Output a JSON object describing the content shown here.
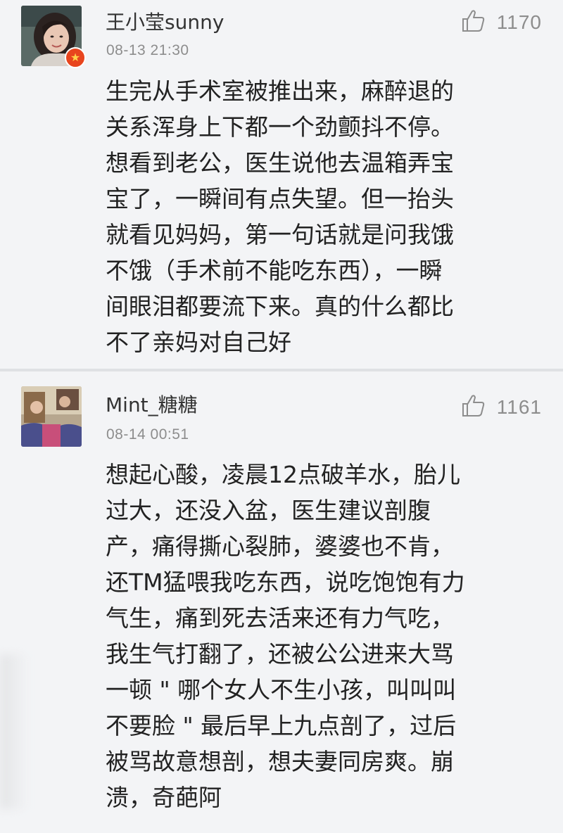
{
  "comments": [
    {
      "username": "王小莹sunny",
      "timestamp": "08-13 21:30",
      "likes": "1170",
      "avatar_icon": "user-avatar-photo",
      "badge_icon": "vip-badge-icon",
      "lines": [
        "生完从手术室被推出来，麻醉退的",
        "关系浑身上下都一个劲颤抖不停。",
        "想看到老公，医生说他去温箱弄宝",
        "宝了，一瞬间有点失望。但一抬头",
        "就看见妈妈，第一句话就是问我饿",
        "不饿（手术前不能吃东西），一瞬",
        "间眼泪都要流下来。真的什么都比",
        "不了亲妈对自己好"
      ]
    },
    {
      "username": "Mint_糖糖",
      "timestamp": "08-14 00:51",
      "likes": "1161",
      "avatar_icon": "user-avatar-photo",
      "lines": [
        "想起心酸，凌晨12点破羊水，胎儿",
        "过大，还没入盆，医生建议剖腹",
        "产，痛得撕心裂肺，婆婆也不肯，",
        "还TM猛喂我吃东西，说吃饱饱有力",
        "气生，痛到死去活来还有力气吃，",
        "我生气打翻了，还被公公进来大骂",
        "一顿 \" 哪个女人不生小孩，叫叫叫",
        "不要脸 \" 最后早上九点剖了，过后",
        "被骂故意想剖，想夫妻同房爽。崩",
        "溃，奇葩阿"
      ]
    }
  ],
  "colors": {
    "background": "#f3f4f6",
    "text": "#222222",
    "meta": "#8d8d8d",
    "divider": "#dfe1e4",
    "badge": "#e8451e"
  },
  "like_icon": "thumbs-up-icon"
}
